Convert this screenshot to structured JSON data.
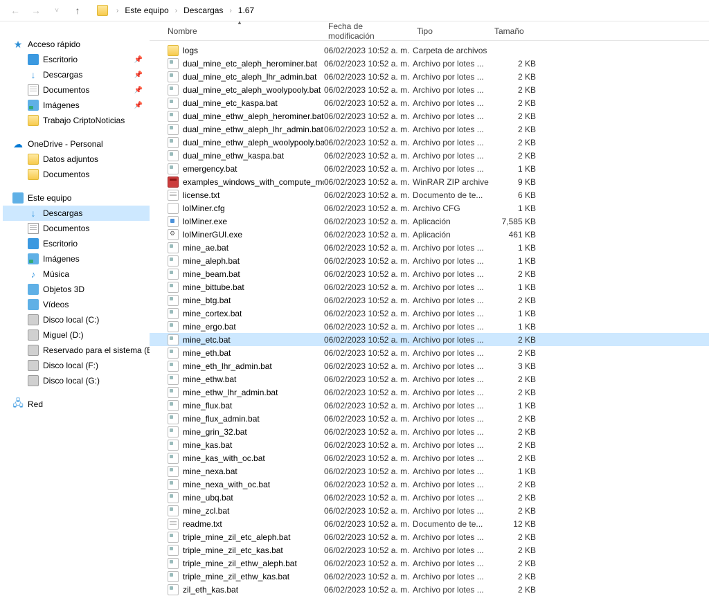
{
  "breadcrumb": [
    "Este equipo",
    "Descargas",
    "1.67"
  ],
  "sidebar": {
    "quick_access": {
      "label": "Acceso rápido",
      "items": [
        {
          "icon": "desktop",
          "label": "Escritorio",
          "pinned": true
        },
        {
          "icon": "downloads",
          "label": "Descargas",
          "pinned": true
        },
        {
          "icon": "docs",
          "label": "Documentos",
          "pinned": true
        },
        {
          "icon": "images",
          "label": "Imágenes",
          "pinned": true
        },
        {
          "icon": "folder",
          "label": "Trabajo CriptoNoticias",
          "pinned": false
        }
      ]
    },
    "onedrive": {
      "label": "OneDrive - Personal",
      "items": [
        {
          "icon": "folder",
          "label": "Datos adjuntos"
        },
        {
          "icon": "folder",
          "label": "Documentos"
        }
      ]
    },
    "this_pc": {
      "label": "Este equipo",
      "items": [
        {
          "icon": "downloads",
          "label": "Descargas",
          "selected": true
        },
        {
          "icon": "docs",
          "label": "Documentos"
        },
        {
          "icon": "desktop",
          "label": "Escritorio"
        },
        {
          "icon": "images",
          "label": "Imágenes"
        },
        {
          "icon": "music",
          "label": "Música"
        },
        {
          "icon": "3d",
          "label": "Objetos 3D"
        },
        {
          "icon": "video",
          "label": "Vídeos"
        },
        {
          "icon": "disk",
          "label": "Disco local (C:)"
        },
        {
          "icon": "disk",
          "label": "Miguel (D:)"
        },
        {
          "icon": "disk",
          "label": "Reservado para el sistema (E:)"
        },
        {
          "icon": "disk",
          "label": "Disco local (F:)"
        },
        {
          "icon": "disk",
          "label": "Disco local (G:)"
        }
      ]
    },
    "network": {
      "label": "Red"
    }
  },
  "columns": {
    "name": "Nombre",
    "date": "Fecha de modificación",
    "type": "Tipo",
    "size": "Tamaño"
  },
  "files": [
    {
      "icon": "folder",
      "name": "logs",
      "date": "06/02/2023 10:52 a. m.",
      "type": "Carpeta de archivos",
      "size": ""
    },
    {
      "icon": "bat",
      "name": "dual_mine_etc_aleph_herominer.bat",
      "date": "06/02/2023 10:52 a. m.",
      "type": "Archivo por lotes ...",
      "size": "2 KB"
    },
    {
      "icon": "bat",
      "name": "dual_mine_etc_aleph_lhr_admin.bat",
      "date": "06/02/2023 10:52 a. m.",
      "type": "Archivo por lotes ...",
      "size": "2 KB"
    },
    {
      "icon": "bat",
      "name": "dual_mine_etc_aleph_woolypooly.bat",
      "date": "06/02/2023 10:52 a. m.",
      "type": "Archivo por lotes ...",
      "size": "2 KB"
    },
    {
      "icon": "bat",
      "name": "dual_mine_etc_kaspa.bat",
      "date": "06/02/2023 10:52 a. m.",
      "type": "Archivo por lotes ...",
      "size": "2 KB"
    },
    {
      "icon": "bat",
      "name": "dual_mine_ethw_aleph_herominer.bat",
      "date": "06/02/2023 10:52 a. m.",
      "type": "Archivo por lotes ...",
      "size": "2 KB"
    },
    {
      "icon": "bat",
      "name": "dual_mine_ethw_aleph_lhr_admin.bat",
      "date": "06/02/2023 10:52 a. m.",
      "type": "Archivo por lotes ...",
      "size": "2 KB"
    },
    {
      "icon": "bat",
      "name": "dual_mine_ethw_aleph_woolypooly.bat",
      "date": "06/02/2023 10:52 a. m.",
      "type": "Archivo por lotes ...",
      "size": "2 KB"
    },
    {
      "icon": "bat",
      "name": "dual_mine_ethw_kaspa.bat",
      "date": "06/02/2023 10:52 a. m.",
      "type": "Archivo por lotes ...",
      "size": "2 KB"
    },
    {
      "icon": "bat",
      "name": "emergency.bat",
      "date": "06/02/2023 10:52 a. m.",
      "type": "Archivo por lotes ...",
      "size": "1 KB"
    },
    {
      "icon": "rar",
      "name": "examples_windows_with_compute_mod...",
      "date": "06/02/2023 10:52 a. m.",
      "type": "WinRAR ZIP archive",
      "size": "9 KB"
    },
    {
      "icon": "txt",
      "name": "license.txt",
      "date": "06/02/2023 10:52 a. m.",
      "type": "Documento de te...",
      "size": "6 KB"
    },
    {
      "icon": "cfg",
      "name": "lolMiner.cfg",
      "date": "06/02/2023 10:52 a. m.",
      "type": "Archivo CFG",
      "size": "1 KB"
    },
    {
      "icon": "exe",
      "name": "lolMiner.exe",
      "date": "06/02/2023 10:52 a. m.",
      "type": "Aplicación",
      "size": "7,585 KB"
    },
    {
      "icon": "exe2",
      "name": "lolMinerGUI.exe",
      "date": "06/02/2023 10:52 a. m.",
      "type": "Aplicación",
      "size": "461 KB"
    },
    {
      "icon": "bat",
      "name": "mine_ae.bat",
      "date": "06/02/2023 10:52 a. m.",
      "type": "Archivo por lotes ...",
      "size": "1 KB"
    },
    {
      "icon": "bat",
      "name": "mine_aleph.bat",
      "date": "06/02/2023 10:52 a. m.",
      "type": "Archivo por lotes ...",
      "size": "1 KB"
    },
    {
      "icon": "bat",
      "name": "mine_beam.bat",
      "date": "06/02/2023 10:52 a. m.",
      "type": "Archivo por lotes ...",
      "size": "2 KB"
    },
    {
      "icon": "bat",
      "name": "mine_bittube.bat",
      "date": "06/02/2023 10:52 a. m.",
      "type": "Archivo por lotes ...",
      "size": "1 KB"
    },
    {
      "icon": "bat",
      "name": "mine_btg.bat",
      "date": "06/02/2023 10:52 a. m.",
      "type": "Archivo por lotes ...",
      "size": "2 KB"
    },
    {
      "icon": "bat",
      "name": "mine_cortex.bat",
      "date": "06/02/2023 10:52 a. m.",
      "type": "Archivo por lotes ...",
      "size": "1 KB"
    },
    {
      "icon": "bat",
      "name": "mine_ergo.bat",
      "date": "06/02/2023 10:52 a. m.",
      "type": "Archivo por lotes ...",
      "size": "1 KB"
    },
    {
      "icon": "bat",
      "name": "mine_etc.bat",
      "date": "06/02/2023 10:52 a. m.",
      "type": "Archivo por lotes ...",
      "size": "2 KB",
      "selected": true
    },
    {
      "icon": "bat",
      "name": "mine_eth.bat",
      "date": "06/02/2023 10:52 a. m.",
      "type": "Archivo por lotes ...",
      "size": "2 KB"
    },
    {
      "icon": "bat",
      "name": "mine_eth_lhr_admin.bat",
      "date": "06/02/2023 10:52 a. m.",
      "type": "Archivo por lotes ...",
      "size": "3 KB"
    },
    {
      "icon": "bat",
      "name": "mine_ethw.bat",
      "date": "06/02/2023 10:52 a. m.",
      "type": "Archivo por lotes ...",
      "size": "2 KB"
    },
    {
      "icon": "bat",
      "name": "mine_ethw_lhr_admin.bat",
      "date": "06/02/2023 10:52 a. m.",
      "type": "Archivo por lotes ...",
      "size": "2 KB"
    },
    {
      "icon": "bat",
      "name": "mine_flux.bat",
      "date": "06/02/2023 10:52 a. m.",
      "type": "Archivo por lotes ...",
      "size": "1 KB"
    },
    {
      "icon": "bat",
      "name": "mine_flux_admin.bat",
      "date": "06/02/2023 10:52 a. m.",
      "type": "Archivo por lotes ...",
      "size": "2 KB"
    },
    {
      "icon": "bat",
      "name": "mine_grin_32.bat",
      "date": "06/02/2023 10:52 a. m.",
      "type": "Archivo por lotes ...",
      "size": "2 KB"
    },
    {
      "icon": "bat",
      "name": "mine_kas.bat",
      "date": "06/02/2023 10:52 a. m.",
      "type": "Archivo por lotes ...",
      "size": "2 KB"
    },
    {
      "icon": "bat",
      "name": "mine_kas_with_oc.bat",
      "date": "06/02/2023 10:52 a. m.",
      "type": "Archivo por lotes ...",
      "size": "2 KB"
    },
    {
      "icon": "bat",
      "name": "mine_nexa.bat",
      "date": "06/02/2023 10:52 a. m.",
      "type": "Archivo por lotes ...",
      "size": "1 KB"
    },
    {
      "icon": "bat",
      "name": "mine_nexa_with_oc.bat",
      "date": "06/02/2023 10:52 a. m.",
      "type": "Archivo por lotes ...",
      "size": "2 KB"
    },
    {
      "icon": "bat",
      "name": "mine_ubq.bat",
      "date": "06/02/2023 10:52 a. m.",
      "type": "Archivo por lotes ...",
      "size": "2 KB"
    },
    {
      "icon": "bat",
      "name": "mine_zcl.bat",
      "date": "06/02/2023 10:52 a. m.",
      "type": "Archivo por lotes ...",
      "size": "2 KB"
    },
    {
      "icon": "txt",
      "name": "readme.txt",
      "date": "06/02/2023 10:52 a. m.",
      "type": "Documento de te...",
      "size": "12 KB"
    },
    {
      "icon": "bat",
      "name": "triple_mine_zil_etc_aleph.bat",
      "date": "06/02/2023 10:52 a. m.",
      "type": "Archivo por lotes ...",
      "size": "2 KB"
    },
    {
      "icon": "bat",
      "name": "triple_mine_zil_etc_kas.bat",
      "date": "06/02/2023 10:52 a. m.",
      "type": "Archivo por lotes ...",
      "size": "2 KB"
    },
    {
      "icon": "bat",
      "name": "triple_mine_zil_ethw_aleph.bat",
      "date": "06/02/2023 10:52 a. m.",
      "type": "Archivo por lotes ...",
      "size": "2 KB"
    },
    {
      "icon": "bat",
      "name": "triple_mine_zil_ethw_kas.bat",
      "date": "06/02/2023 10:52 a. m.",
      "type": "Archivo por lotes ...",
      "size": "2 KB"
    },
    {
      "icon": "bat",
      "name": "zil_eth_kas.bat",
      "date": "06/02/2023 10:52 a. m.",
      "type": "Archivo por lotes ...",
      "size": "2 KB"
    }
  ]
}
